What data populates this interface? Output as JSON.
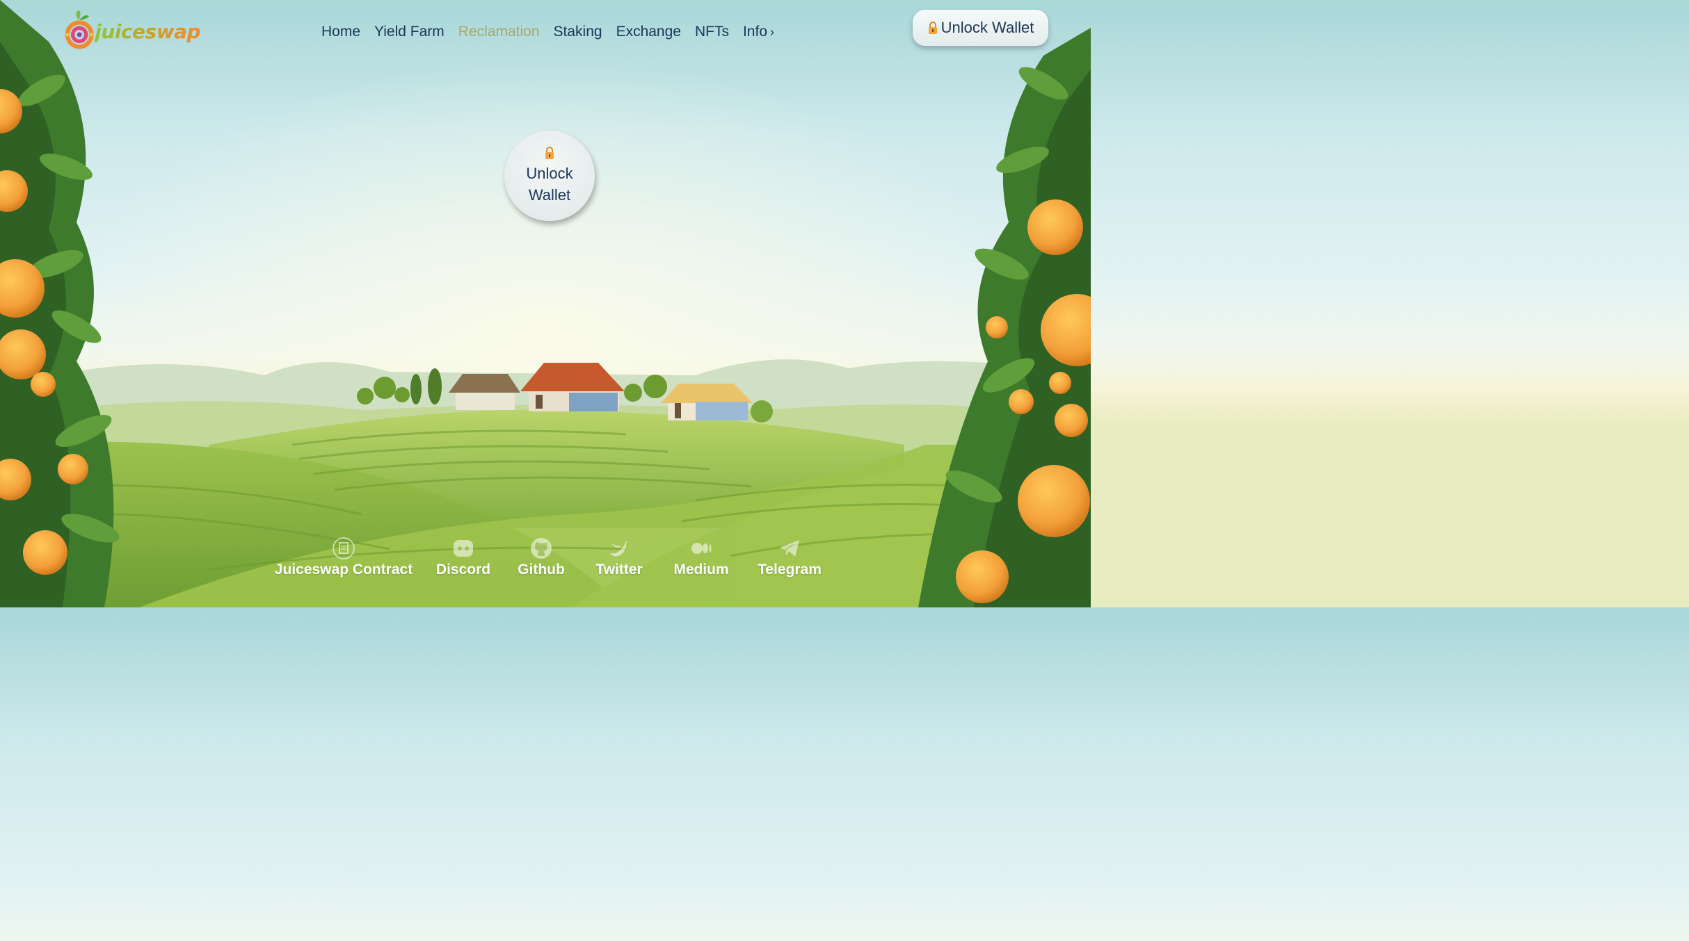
{
  "brand": {
    "name": "juiceswap"
  },
  "nav": {
    "items": [
      {
        "label": "Home",
        "active": false
      },
      {
        "label": "Yield Farm",
        "active": false
      },
      {
        "label": "Reclamation",
        "active": true
      },
      {
        "label": "Staking",
        "active": false
      },
      {
        "label": "Exchange",
        "active": false
      },
      {
        "label": "NFTs",
        "active": false
      },
      {
        "label": "Info",
        "active": false
      }
    ],
    "info_chevron": "›"
  },
  "header": {
    "wallet_button_label": "Unlock Wallet",
    "wallet_icon": "lock-icon"
  },
  "main": {
    "unlock_line1": "Unlock",
    "unlock_line2": "Wallet",
    "unlock_icon": "lock-icon"
  },
  "footer": {
    "links": [
      {
        "label": "Juiceswap Contract",
        "icon": "contract-icon"
      },
      {
        "label": "Discord",
        "icon": "discord-icon"
      },
      {
        "label": "Github",
        "icon": "github-icon"
      },
      {
        "label": "Twitter",
        "icon": "twitter-icon"
      },
      {
        "label": "Medium",
        "icon": "medium-icon"
      },
      {
        "label": "Telegram",
        "icon": "telegram-icon"
      }
    ]
  },
  "colors": {
    "nav_text": "#1c3557",
    "nav_active": "#a7a86a",
    "orange": "#f2a33a",
    "leaf": "#3e7a2c"
  }
}
